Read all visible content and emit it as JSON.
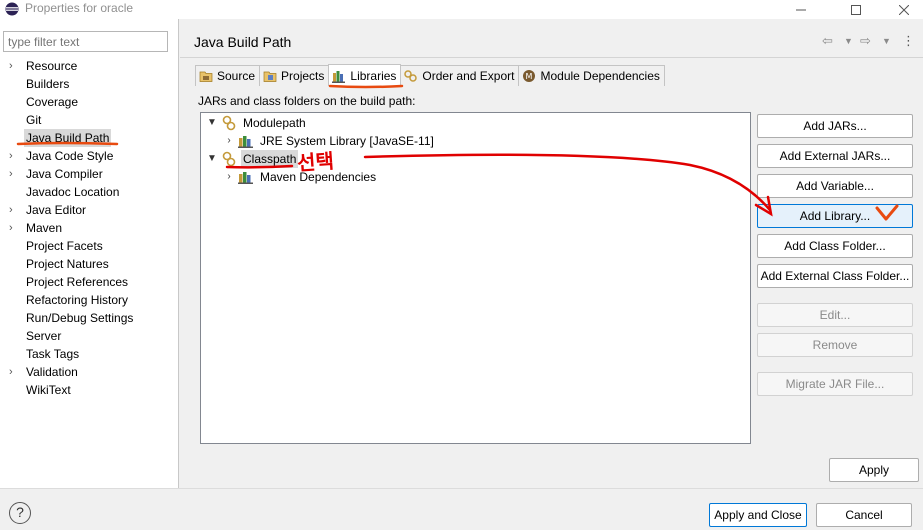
{
  "window": {
    "title": "Properties for oracle",
    "minimize_icon": "minimize-icon",
    "maximize_icon": "maximize-icon",
    "close_icon": "close-icon"
  },
  "filter": {
    "placeholder": "type filter text"
  },
  "nav": {
    "items": [
      {
        "label": "Resource",
        "expandable": true
      },
      {
        "label": "Builders",
        "expandable": false
      },
      {
        "label": "Coverage",
        "expandable": false
      },
      {
        "label": "Git",
        "expandable": false
      },
      {
        "label": "Java Build Path",
        "expandable": false,
        "selected": true
      },
      {
        "label": "Java Code Style",
        "expandable": true
      },
      {
        "label": "Java Compiler",
        "expandable": true
      },
      {
        "label": "Javadoc Location",
        "expandable": false
      },
      {
        "label": "Java Editor",
        "expandable": true
      },
      {
        "label": "Maven",
        "expandable": true
      },
      {
        "label": "Project Facets",
        "expandable": false
      },
      {
        "label": "Project Natures",
        "expandable": false
      },
      {
        "label": "Project References",
        "expandable": false
      },
      {
        "label": "Refactoring History",
        "expandable": false
      },
      {
        "label": "Run/Debug Settings",
        "expandable": false
      },
      {
        "label": "Server",
        "expandable": false
      },
      {
        "label": "Task Tags",
        "expandable": false
      },
      {
        "label": "Validation",
        "expandable": true
      },
      {
        "label": "WikiText",
        "expandable": false
      }
    ]
  },
  "page": {
    "title": "Java Build Path",
    "tabs": [
      {
        "label": "Source",
        "icon": "source-folder-icon"
      },
      {
        "label": "Projects",
        "icon": "projects-icon"
      },
      {
        "label": "Libraries",
        "icon": "libraries-icon",
        "active": true
      },
      {
        "label": "Order and Export",
        "icon": "order-export-icon"
      },
      {
        "label": "Module Dependencies",
        "icon": "module-icon"
      }
    ],
    "instructions": "JARs and class folders on the build path:",
    "tree": {
      "modulepath": "Modulepath",
      "jre": "JRE System Library [JavaSE-11]",
      "classpath": "Classpath",
      "maven": "Maven Dependencies"
    },
    "buttons": {
      "add_jars": "Add JARs...",
      "add_external_jars": "Add External JARs...",
      "add_variable": "Add Variable...",
      "add_library": "Add Library...",
      "add_class_folder": "Add Class Folder...",
      "add_external_class_folder": "Add External Class Folder...",
      "edit": "Edit...",
      "remove": "Remove",
      "migrate_jar": "Migrate JAR File..."
    },
    "apply": "Apply"
  },
  "footer": {
    "help": "?",
    "apply_close": "Apply and Close",
    "cancel": "Cancel"
  },
  "annotation": {
    "text": "선택",
    "color": "#e00000"
  }
}
